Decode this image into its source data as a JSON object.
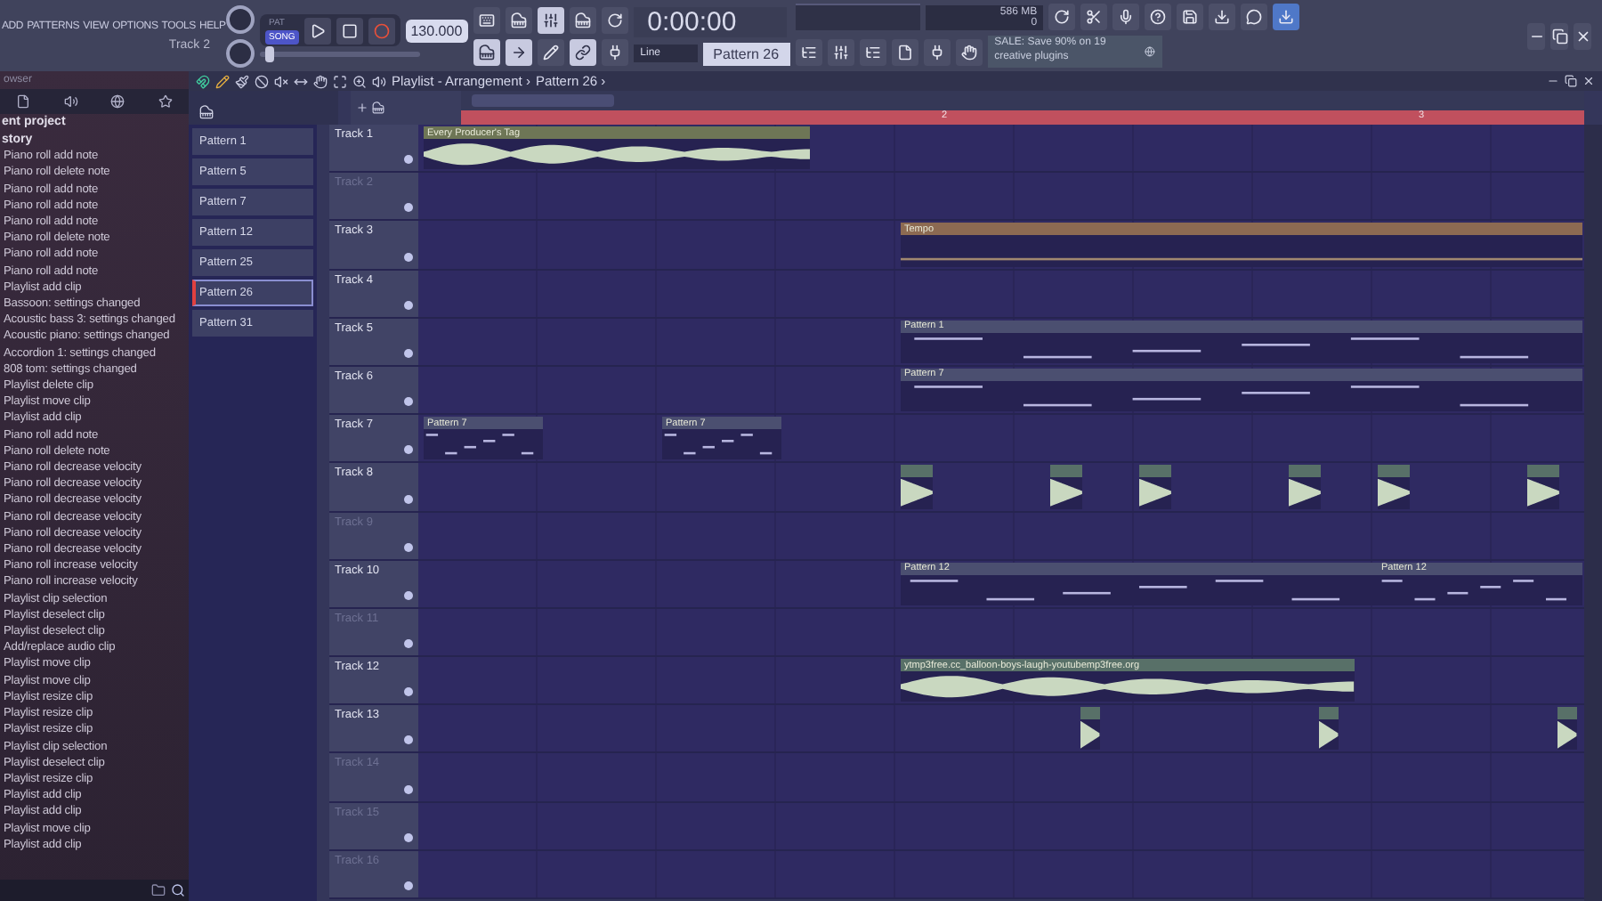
{
  "menu": [
    "ADD",
    "PATTERNS",
    "VIEW",
    "OPTIONS",
    "TOOLS",
    "HELP"
  ],
  "hint": "Track 2",
  "master_pitch": {
    "level": 0.05
  },
  "transport": {
    "modes": [
      {
        "label": "PAT",
        "selected": false
      },
      {
        "label": "SONG",
        "selected": true
      }
    ],
    "tempo": "130.000",
    "time": "0:00:00",
    "memory": "586 MB",
    "voices": "0"
  },
  "snap": "Line",
  "pattern": "Pattern 26",
  "news": "SALE: Save 90% on 19 creative plugins",
  "browser": {
    "title": "owser",
    "sections": [
      "ent project",
      "story"
    ],
    "history": [
      "Piano roll add note",
      "Piano roll delete note",
      "Piano roll add note",
      "Piano roll add note",
      "Piano roll add note",
      "Piano roll delete note",
      "Piano roll add note",
      "Piano roll add note",
      "Playlist add clip",
      "Bassoon: settings changed",
      "Acoustic bass 3: settings changed",
      "Acoustic piano: settings changed",
      "Accordion 1: settings changed",
      "808 tom: settings changed",
      "Playlist delete clip",
      "Playlist move clip",
      "Playlist add clip",
      "Piano roll add note",
      "Piano roll delete note",
      "Piano roll decrease velocity",
      "Piano roll decrease velocity",
      "Piano roll decrease velocity",
      "Piano roll decrease velocity",
      "Piano roll decrease velocity",
      "Piano roll decrease velocity",
      "Piano roll increase velocity",
      "Piano roll increase velocity",
      "Playlist clip selection",
      "Playlist deselect clip",
      "Playlist deselect clip",
      "Add/replace audio clip",
      "Playlist move clip",
      "Playlist move clip",
      "Playlist resize clip",
      "Playlist resize clip",
      "Playlist resize clip",
      "Playlist clip selection",
      "Playlist deselect clip",
      "Playlist resize clip",
      "Playlist add clip",
      "Playlist add clip",
      "Playlist move clip",
      "Playlist add clip"
    ]
  },
  "playlist": {
    "title": "Playlist - Arrangement ›",
    "crumb": "Pattern 26 ›",
    "patterns": [
      {
        "name": "Pattern 1",
        "selected": false
      },
      {
        "name": "Pattern 5",
        "selected": false
      },
      {
        "name": "Pattern 7",
        "selected": false
      },
      {
        "name": "Pattern 12",
        "selected": false
      },
      {
        "name": "Pattern 25",
        "selected": false
      },
      {
        "name": "Pattern 26",
        "selected": true
      },
      {
        "name": "Pattern 31",
        "selected": false
      }
    ],
    "ruler": [
      "2",
      "3"
    ],
    "tracks": [
      {
        "name": "Track 1",
        "dimmed": false,
        "clips": [
          {
            "kind": "audio",
            "label": "Every Producer's Tag",
            "color": "#6e7656"
          }
        ]
      },
      {
        "name": "Track 2",
        "dimmed": true
      },
      {
        "name": "Track 3",
        "dimmed": false,
        "clips": [
          {
            "kind": "automation",
            "label": "Tempo",
            "color": "#8c6a52"
          }
        ]
      },
      {
        "name": "Track 4",
        "dimmed": false
      },
      {
        "name": "Track 5",
        "dimmed": false,
        "clips": [
          {
            "kind": "pattern",
            "label": "Pattern 1",
            "color": "#4b4f70"
          }
        ]
      },
      {
        "name": "Track 6",
        "dimmed": false,
        "clips": [
          {
            "kind": "pattern",
            "label": "Pattern 7",
            "color": "#4b4f70"
          }
        ]
      },
      {
        "name": "Track 7",
        "dimmed": false,
        "clips": [
          {
            "kind": "pattern",
            "label": "Pattern 7",
            "color": "#4b4f70"
          },
          {
            "kind": "pattern",
            "label": "Pattern 7",
            "color": "#4b4f70"
          }
        ]
      },
      {
        "name": "Track 8",
        "dimmed": false,
        "clips": [
          {
            "kind": "slice",
            "color": "#587068"
          },
          {
            "kind": "slice",
            "color": "#587068"
          },
          {
            "kind": "slice",
            "color": "#587068"
          },
          {
            "kind": "slice",
            "color": "#587068"
          },
          {
            "kind": "slice",
            "color": "#587068"
          },
          {
            "kind": "slice",
            "color": "#587068"
          }
        ]
      },
      {
        "name": "Track 9",
        "dimmed": true
      },
      {
        "name": "Track 10",
        "dimmed": false,
        "clips": [
          {
            "kind": "pattern",
            "label": "Pattern 12",
            "color": "#4b4f70"
          },
          {
            "kind": "pattern",
            "label": "Pattern 12",
            "color": "#4b4f70"
          }
        ]
      },
      {
        "name": "Track 11",
        "dimmed": true
      },
      {
        "name": "Track 12",
        "dimmed": false,
        "clips": [
          {
            "kind": "audio",
            "label": "ytmp3free.cc_balloon-boys-laugh-youtubemp3free.org",
            "color": "#587068"
          }
        ]
      },
      {
        "name": "Track 13",
        "dimmed": false,
        "clips": [
          {
            "kind": "slice",
            "color": "#587068"
          },
          {
            "kind": "slice",
            "color": "#587068"
          },
          {
            "kind": "slice",
            "color": "#587068"
          }
        ]
      },
      {
        "name": "Track 14",
        "dimmed": true
      },
      {
        "name": "Track 15",
        "dimmed": true
      },
      {
        "name": "Track 16",
        "dimmed": true
      }
    ]
  }
}
